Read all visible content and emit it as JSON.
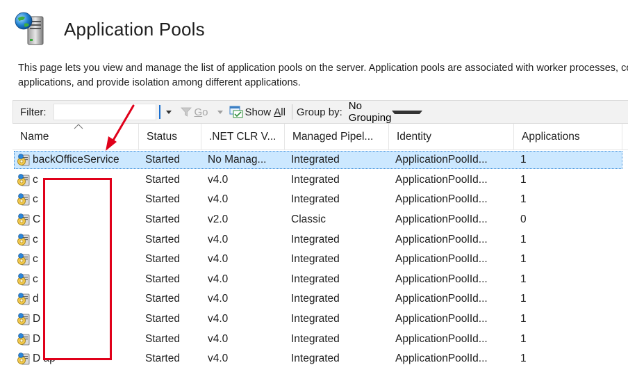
{
  "page": {
    "title": "Application Pools",
    "description_line1": "This page lets you view and manage the list of application pools on the server. Application pools are associated with worker processes, contain one or more",
    "description_line2": "applications, and provide isolation among different applications."
  },
  "toolbar": {
    "filter_label": "Filter:",
    "filter_value": "",
    "go_prefix": "",
    "go_label_u": "G",
    "go_label_rest": "o",
    "show_prefix": "Show ",
    "show_all_u": "A",
    "show_all_rest": "ll",
    "group_by_label": "Group by:",
    "group_by_value": "No Grouping"
  },
  "columns": {
    "name": "Name",
    "status": "Status",
    "clr": ".NET CLR V...",
    "pipeline": "Managed Pipel...",
    "identity": "Identity",
    "applications": "Applications"
  },
  "rows": [
    {
      "name": "backOfficeService",
      "status": "Started",
      "clr": "No Manag...",
      "pipeline": "Integrated",
      "identity": "ApplicationPoolId...",
      "applications": "1"
    },
    {
      "name": "c",
      "status": "Started",
      "clr": "v4.0",
      "pipeline": "Integrated",
      "identity": "ApplicationPoolId...",
      "applications": "1"
    },
    {
      "name": "c",
      "status": "Started",
      "clr": "v4.0",
      "pipeline": "Integrated",
      "identity": "ApplicationPoolId...",
      "applications": "1"
    },
    {
      "name": "C p...",
      "status": "Started",
      "clr": "v2.0",
      "pipeline": "Classic",
      "identity": "ApplicationPoolId...",
      "applications": "0"
    },
    {
      "name": "c",
      "status": "Started",
      "clr": "v4.0",
      "pipeline": "Integrated",
      "identity": "ApplicationPoolId...",
      "applications": "1"
    },
    {
      "name": "c",
      "status": "Started",
      "clr": "v4.0",
      "pipeline": "Integrated",
      "identity": "ApplicationPoolId...",
      "applications": "1"
    },
    {
      "name": "c",
      "status": "Started",
      "clr": "v4.0",
      "pipeline": "Integrated",
      "identity": "ApplicationPoolId...",
      "applications": "1"
    },
    {
      "name": "d",
      "status": "Started",
      "clr": "v4.0",
      "pipeline": "Integrated",
      "identity": "ApplicationPoolId...",
      "applications": "1"
    },
    {
      "name": "D ol",
      "status": "Started",
      "clr": "v4.0",
      "pipeline": "Integrated",
      "identity": "ApplicationPoolId...",
      "applications": "1"
    },
    {
      "name": "D",
      "status": "Started",
      "clr": "v4.0",
      "pipeline": "Integrated",
      "identity": "ApplicationPoolId...",
      "applications": "1"
    },
    {
      "name": "D ap",
      "status": "Started",
      "clr": "v4.0",
      "pipeline": "Integrated",
      "identity": "ApplicationPoolId...",
      "applications": "1"
    }
  ],
  "icons": {
    "page": "application-pools-icon",
    "row": "app-pool-icon",
    "go": "funnel-icon",
    "show_all": "show-all-icon"
  },
  "colors": {
    "selection": "#cce8ff",
    "annotation": "#e0001a"
  }
}
